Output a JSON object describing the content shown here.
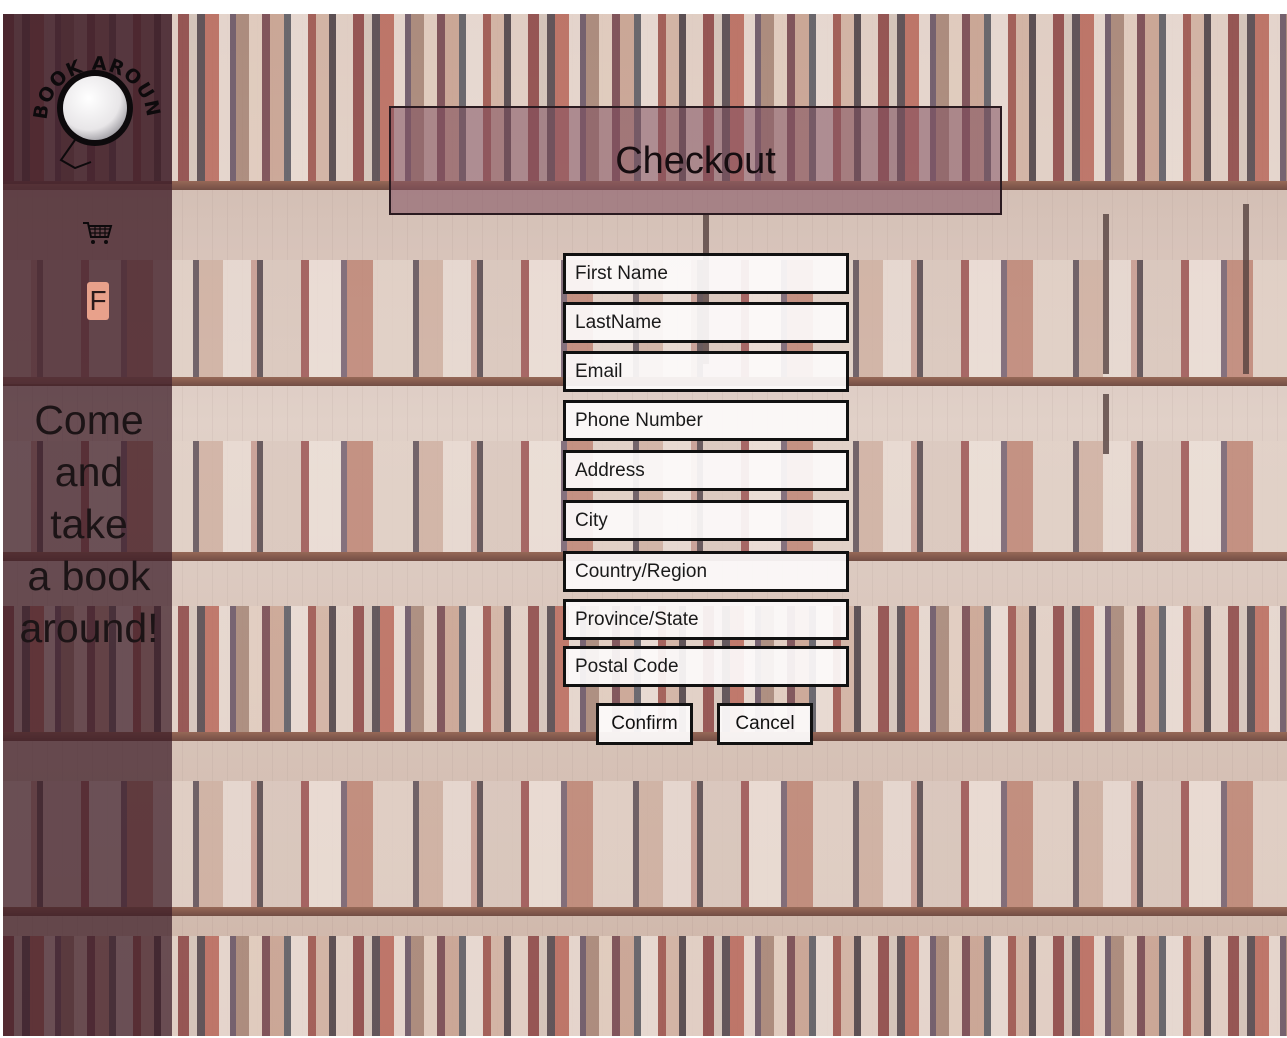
{
  "brand": {
    "logo_text": "BOOK AROUND"
  },
  "sidebar": {
    "cart_icon": "shopping-cart-icon",
    "profile_initial": "F",
    "tagline": [
      "Come",
      "and",
      "take",
      "a book",
      "around!"
    ]
  },
  "checkout": {
    "title": "Checkout",
    "fields": {
      "first_name": "First Name",
      "last_name": "LastName",
      "email": "Email",
      "phone": "Phone Number",
      "address": "Address",
      "city": "City",
      "country": "Country/Region",
      "province": "Province/State",
      "postal": "Postal Code"
    },
    "confirm_label": "Confirm",
    "cancel_label": "Cancel"
  },
  "colors": {
    "sidebar": "#3a1a26",
    "title_bar": "#804e5e",
    "profile_badge": "#e8a18b"
  }
}
